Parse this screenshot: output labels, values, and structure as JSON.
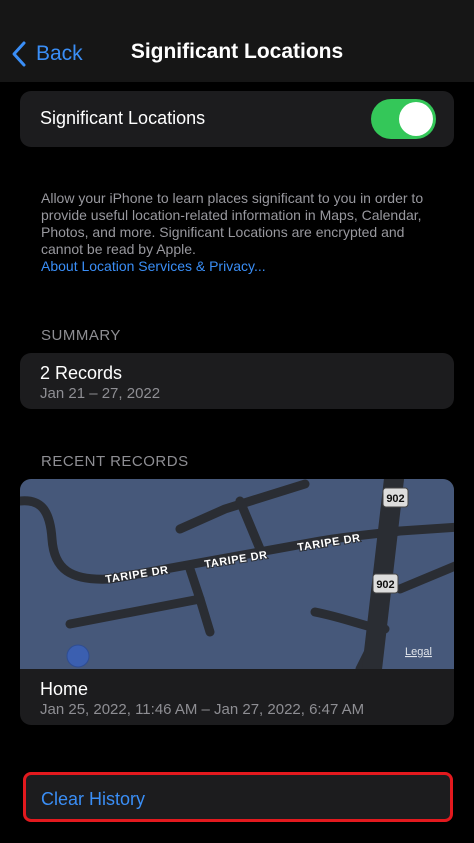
{
  "nav": {
    "back_label": "Back",
    "title": "Significant Locations"
  },
  "toggle": {
    "label": "Significant Locations",
    "on": true,
    "color": "#34c759"
  },
  "description": {
    "text": "Allow your iPhone to learn places significant to you in order to provide useful location-related information in Maps, Calendar, Photos, and more. Significant Locations are encrypted and cannot be read by Apple.",
    "link": "About Location Services & Privacy..."
  },
  "summary": {
    "header": "SUMMARY",
    "title": "2 Records",
    "dates": "Jan 21 – 27, 2022"
  },
  "recent": {
    "header": "RECENT RECORDS",
    "map": {
      "street_labels": [
        "TARIPE DR",
        "TARIPE DR",
        "TARIPE DR"
      ],
      "route_badges": [
        "902",
        "902"
      ],
      "legal": "Legal"
    },
    "record": {
      "title": "Home",
      "dates": "Jan 25, 2022, 11:46 AM – Jan 27, 2022, 6:47 AM"
    }
  },
  "actions": {
    "clear_history": "Clear History"
  },
  "colors": {
    "accent": "#3a8ef6",
    "highlight": "#e3191e",
    "map_bg": "#46587a"
  }
}
